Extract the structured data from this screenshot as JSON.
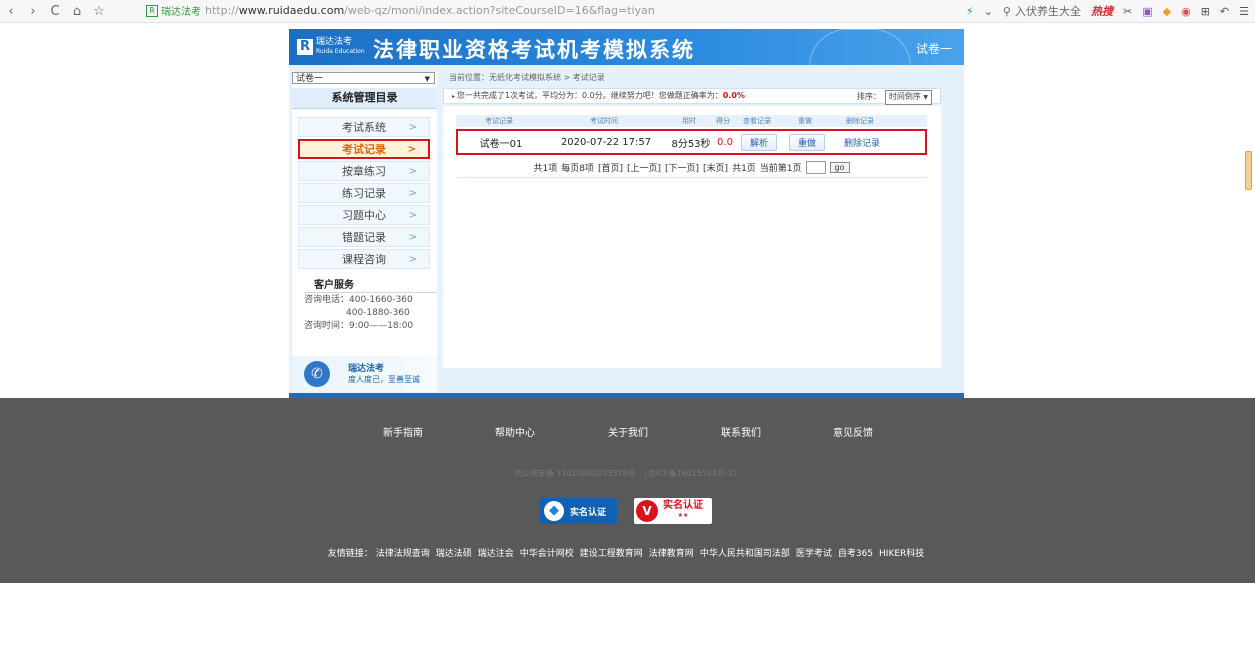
{
  "browser": {
    "back": "‹",
    "forward": "›",
    "reload": "C",
    "home": "⌂",
    "star": "☆",
    "site_name": "瑞达法考",
    "url_scheme": "http://",
    "url_host": "www.ruidaedu.com",
    "url_path": "/web-qz/moni/index.action?siteCourseID=16&flag=tiyan",
    "search_placeholder": "入伏养生大全",
    "hot_label": "热搜"
  },
  "banner": {
    "logo_mark": "R",
    "logo_text": "瑞达法考",
    "logo_sub": "Ruida Education",
    "title": "法律职业资格考试机考模拟系统",
    "paper_name": "试卷一"
  },
  "sidebar": {
    "paper_select_value": "试卷一",
    "head": "系统管理目录",
    "items": [
      {
        "label": "考试系统"
      },
      {
        "label": "考试记录"
      },
      {
        "label": "按章练习"
      },
      {
        "label": "练习记录"
      },
      {
        "label": "习题中心"
      },
      {
        "label": "错题记录"
      },
      {
        "label": "课程咨询"
      }
    ],
    "chevron": ">",
    "cs_head": "客户服务",
    "phone_label": "咨询电话：400-1660-360",
    "phone_2": "400-1880-360",
    "hours": "咨询时间：9:00——18:00",
    "brand_name": "瑞达法考",
    "brand_slogan": "度人度己，至善至诚"
  },
  "main": {
    "breadcrumb": "当前位置：无纸化考试模拟系统 > 考试记录",
    "summary": "您一共完成了1次考试，平均分为：0.0分。继续努力吧！您做题正确率为：",
    "accuracy": "0.0%",
    "sort_label": "排序：",
    "sort_value": "时间倒序",
    "table": {
      "headers": [
        "考试记录",
        "考试时间",
        "用时",
        "得分",
        "查看记录",
        "重做",
        "删除记录"
      ],
      "rows": [
        {
          "name": "试卷一01",
          "time": "2020-07-22 17:57",
          "duration": "8分53秒",
          "score": "0.0",
          "view": "解析",
          "redo": "重做",
          "delete": "删除记录"
        }
      ]
    },
    "pager": {
      "total": "共1项",
      "per_page": "每页8项",
      "first": "[首页]",
      "prev": "[上一页]",
      "next": "[下一页]",
      "last": "[末页]",
      "pages": "共1页",
      "current": "当前第1页",
      "go": "go"
    }
  },
  "footer": {
    "links": [
      "新手指南",
      "帮助中心",
      "关于我们",
      "联系我们",
      "意见反馈"
    ],
    "icp": "京公网安备 11010802023378号　（京ICP备16015524号-2）",
    "badge1": "实名认证",
    "badge2": "实名认证",
    "badge2_stars": "★★",
    "friends_label": "友情链接：",
    "friends": [
      "法律法规查询",
      "瑞达法硕",
      "瑞达注会",
      "中华会计网校",
      "建设工程教育网",
      "法律教育网",
      "中华人民共和国司法部",
      "医学考试",
      "自考365",
      "HIKER科技"
    ]
  }
}
